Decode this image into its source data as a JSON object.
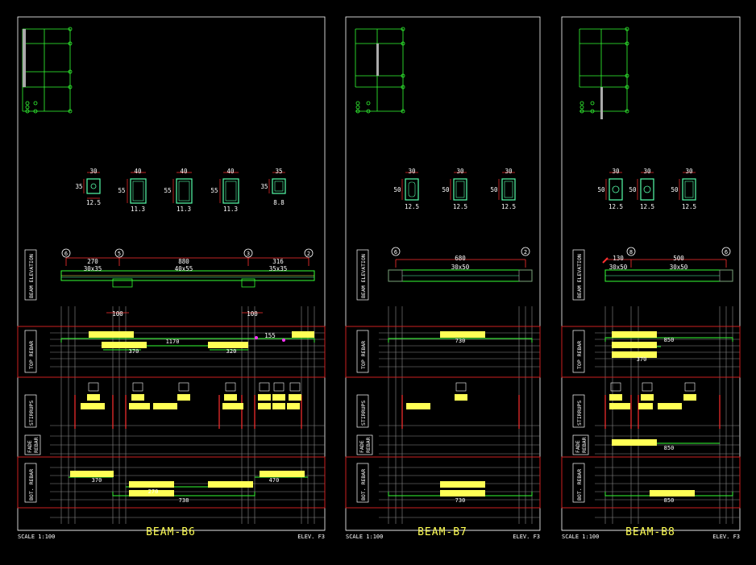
{
  "colors": {
    "background": "#000000",
    "frame": "#ffffff",
    "grid": "#8c8c8c",
    "dimension": "#ff3030",
    "concrete": "#33ff33",
    "section": "#55ffaa",
    "label": "#ffff55",
    "band": "#cc2020",
    "magenta": "#ff33ff"
  },
  "row_labels": {
    "beam_elevation": "BEAM ELEVATION",
    "top_rebar": "TOP REBAR",
    "stirrups": "STIRRUPS",
    "fade_rebar_1": "FADE",
    "fade_rebar_2": "REBAR",
    "bot_rebar": "BOT. REBAR"
  },
  "panels": [
    {
      "title": "BEAM-B6",
      "scale": "SCALE 1:100",
      "elev": "ELEV. F3",
      "sections": [
        {
          "w": "30",
          "h": "35",
          "bot": "12.5"
        },
        {
          "w": "40",
          "h": "55",
          "bot": "11.3"
        },
        {
          "w": "40",
          "h": "55",
          "bot": "11.3"
        },
        {
          "w": "40",
          "h": "55",
          "bot": "11.3"
        },
        {
          "w": "35",
          "h": "35",
          "bot": "8.8"
        }
      ],
      "axes": [
        "6",
        "5",
        "3",
        "2"
      ],
      "spans": [
        "270",
        "880",
        "316"
      ],
      "span_sizes": [
        "30x35",
        "40x55",
        "35x35"
      ],
      "top_dims": [
        "100",
        "100",
        "155"
      ],
      "top_rebar_labels": [
        "1170",
        "370",
        "320"
      ],
      "bot_rebar_labels": [
        "370",
        "270",
        "470",
        "738"
      ]
    },
    {
      "title": "BEAM-B7",
      "scale": "SCALE 1:100",
      "elev": "ELEV. F3",
      "sections": [
        {
          "w": "30",
          "h": "50",
          "bot": "12.5"
        },
        {
          "w": "30",
          "h": "50",
          "bot": "12.5"
        },
        {
          "w": "30",
          "h": "50",
          "bot": "12.5"
        }
      ],
      "axes": [
        "6",
        "2"
      ],
      "spans": [
        "680"
      ],
      "span_sizes": [
        "30x50"
      ],
      "top_dims": [],
      "top_rebar_labels": [
        "730"
      ],
      "bot_rebar_labels": [
        "730"
      ]
    },
    {
      "title": "BEAM-B8",
      "scale": "SCALE 1:100",
      "elev": "ELEV. F3",
      "sections": [
        {
          "w": "30",
          "h": "50",
          "bot": "12.5"
        },
        {
          "w": "30",
          "h": "50",
          "bot": "12.5"
        },
        {
          "w": "30",
          "h": "50",
          "bot": "12.5"
        }
      ],
      "axes": [
        "8",
        "6"
      ],
      "spans": [
        "130",
        "500"
      ],
      "span_sizes": [
        "30x50",
        "30x50"
      ],
      "top_dims": [],
      "top_rebar_labels": [
        "850",
        "370"
      ],
      "bot_rebar_labels": [
        "850",
        "850"
      ]
    }
  ]
}
